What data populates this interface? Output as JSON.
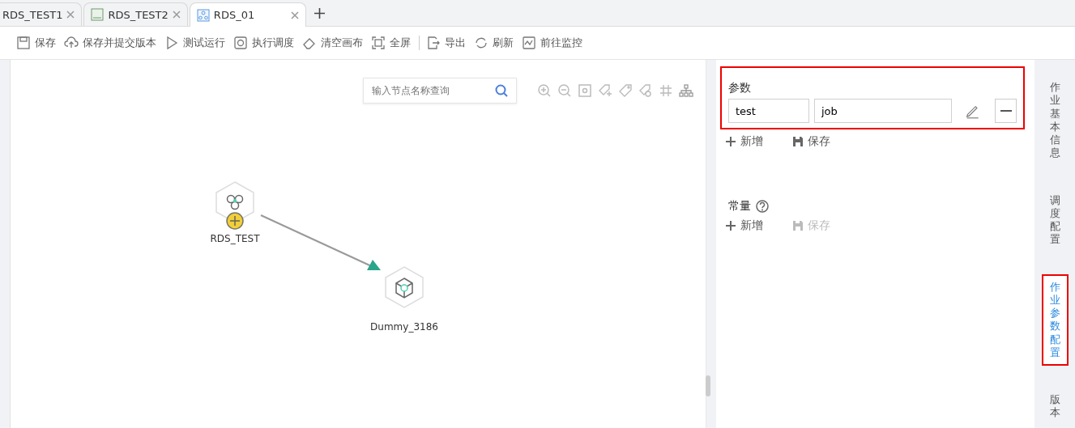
{
  "tabs": [
    {
      "label": "RDS_TEST1",
      "kind": "none",
      "selected": false
    },
    {
      "label": "RDS_TEST2",
      "kind": "rds",
      "selected": false
    },
    {
      "label": "RDS_01",
      "kind": "flow",
      "selected": true
    }
  ],
  "toolbar": [
    {
      "label": "保存",
      "kind": "save"
    },
    {
      "label": "保存并提交版本",
      "kind": "upload"
    },
    {
      "label": "测试运行",
      "kind": "play"
    },
    {
      "label": "执行调度",
      "kind": "cycle"
    },
    {
      "label": "清空画布",
      "kind": "eraser"
    },
    {
      "label": "全屏",
      "kind": "fullscreen"
    },
    {
      "label": "导出",
      "kind": "export"
    },
    {
      "label": "刷新",
      "kind": "refresh"
    },
    {
      "label": "前往监控",
      "kind": "monitor"
    }
  ],
  "search": {
    "placeholder": "输入节点名称查询"
  },
  "nodes": [
    {
      "name": "RDS_TEST",
      "kind": "rds"
    },
    {
      "name": "Dummy_3186",
      "kind": "dummy"
    }
  ],
  "params": {
    "title": "参数",
    "highlighted": true,
    "rows": [
      {
        "name": "test",
        "value": "job"
      }
    ],
    "add": "新增",
    "save": "保存",
    "save_disabled": false
  },
  "constants": {
    "title": "常量",
    "add": "新增",
    "save": "保存",
    "save_disabled": true
  },
  "side_tabs": [
    {
      "label": "作业基本信息",
      "selected": false
    },
    {
      "label": "调度配置",
      "selected": false
    },
    {
      "label": "作业参数配置",
      "selected": true
    },
    {
      "label": "版本",
      "selected": false
    }
  ]
}
